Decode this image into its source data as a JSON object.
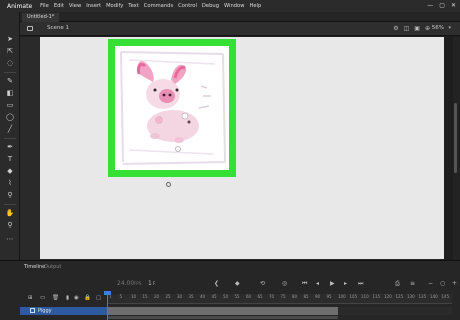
{
  "menubar": {
    "app_name": "Animate",
    "items": [
      "File",
      "Edit",
      "View",
      "Insert",
      "Modify",
      "Text",
      "Commands",
      "Control",
      "Debug",
      "Window",
      "Help"
    ],
    "minimize": "—",
    "maximize": "▢",
    "close": "✕"
  },
  "document": {
    "tab_title": "Untitled-1*"
  },
  "scenebar": {
    "scene_name": "Scene 1",
    "zoom": "56%",
    "zoom_caret": "▾"
  },
  "timeline": {
    "tab_label": "Timeline",
    "output_label": "Output",
    "fps": "24.00",
    "fps_unit": "FPS",
    "frame": "1",
    "frame_unit": "F",
    "ruler_numbers": [
      "1",
      "5",
      "10",
      "15",
      "20",
      "25",
      "30",
      "35",
      "40",
      "45",
      "50",
      "55",
      "60",
      "65",
      "70",
      "75",
      "80",
      "85",
      "90",
      "95",
      "100",
      "105",
      "110",
      "115",
      "120",
      "125",
      "130",
      "135",
      "140",
      "145"
    ],
    "layer_name": "Piggy"
  },
  "colors": {
    "stroke": "#111111",
    "fill": "#e0131b",
    "frame_border": "#35e035",
    "stage": "#e8e8e8"
  }
}
